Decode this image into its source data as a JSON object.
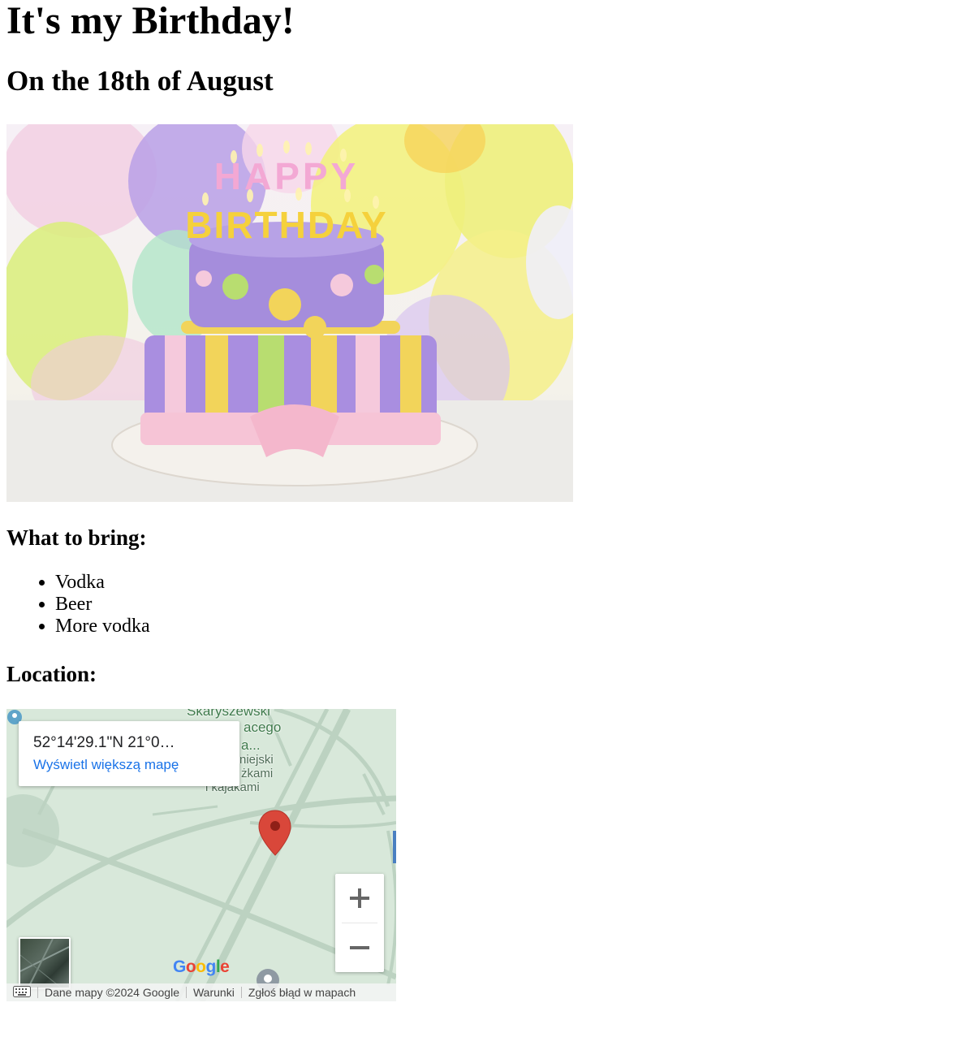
{
  "page": {
    "title": "It's my Birthday!",
    "subtitle": "On the 18th of August",
    "cake_image_alt": "Birthday cake with HAPPY BIRTHDAY candles"
  },
  "cake_candles": {
    "line1": "HAPPY",
    "line2": "BIRTHDAY"
  },
  "bring": {
    "heading": "What to bring:",
    "items": [
      "Vodka",
      "Beer",
      "More vodka"
    ]
  },
  "location": {
    "heading": "Location:"
  },
  "map": {
    "coords": "52°14'29.1\"N 21°0…",
    "view_larger_link": "Wyświetl większą mapę",
    "labels": [
      "Skaryszewski",
      "acego",
      "a...",
      "niejski",
      "żkami",
      "i kajakami"
    ],
    "zoom_in": "+",
    "zoom_out": "−",
    "google_logo": "Google",
    "footer": {
      "map_data": "Dane mapy ©2024 Google",
      "terms": "Warunki",
      "report": "Zgłoś błąd w mapach"
    },
    "colors": {
      "background": "#d8e8da",
      "roads": "#bcd2c1",
      "pin": "#d9473a",
      "link": "#1a73e8"
    }
  }
}
